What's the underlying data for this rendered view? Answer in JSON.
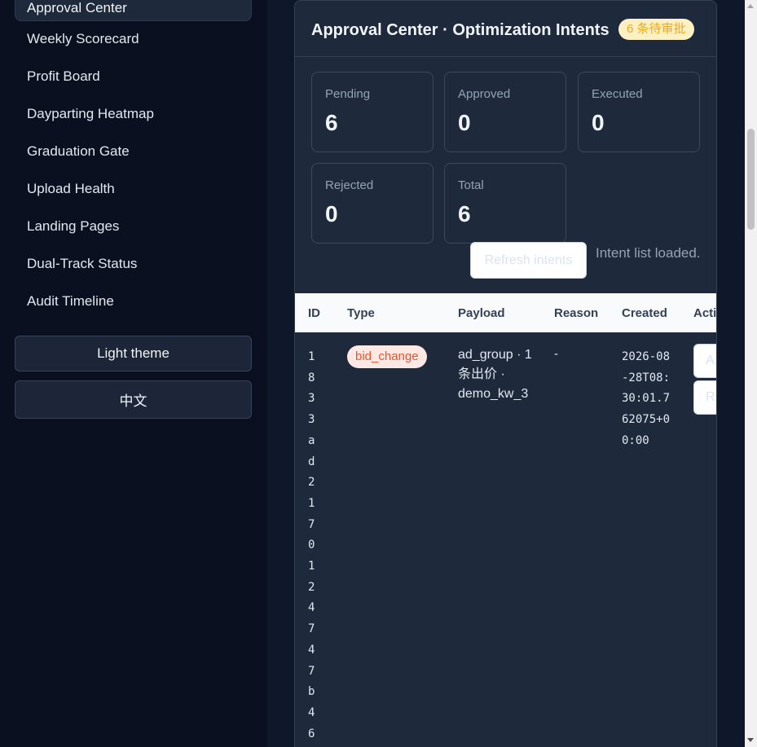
{
  "sidebar": {
    "active_item": "Approval Center",
    "items": [
      {
        "label": "Weekly Scorecard"
      },
      {
        "label": "Profit Board"
      },
      {
        "label": "Dayparting Heatmap"
      },
      {
        "label": "Graduation Gate"
      },
      {
        "label": "Upload Health"
      },
      {
        "label": "Landing Pages"
      },
      {
        "label": "Dual-Track Status"
      },
      {
        "label": "Audit Timeline"
      }
    ],
    "theme_button": "Light theme",
    "language_button": "中文"
  },
  "panel": {
    "title": "Approval Center · Optimization Intents",
    "pending_badge": "6 条待审批"
  },
  "stats": [
    {
      "label": "Pending",
      "value": "6"
    },
    {
      "label": "Approved",
      "value": "0"
    },
    {
      "label": "Executed",
      "value": "0"
    },
    {
      "label": "Rejected",
      "value": "0"
    },
    {
      "label": "Total",
      "value": "6"
    }
  ],
  "actions": {
    "refresh_label": "Refresh intents",
    "status_text": "Intent list loaded."
  },
  "table": {
    "headers": [
      "ID",
      "Type",
      "Payload",
      "Reason",
      "Created",
      "Acti"
    ],
    "rows": [
      {
        "id": "1833ad217012474 7b46",
        "type": "bid_change",
        "payload": "ad_group · 1 条出价 · demo_kw_3",
        "reason": "-",
        "created": "2026-08-28T08:30:01.762075+00:00",
        "approve_label": "A",
        "reject_label": "R"
      }
    ]
  },
  "colors": {
    "background": "#0c1222",
    "card": "#1e293b",
    "badge_bg": "#fdf0c2",
    "badge_text": "#f0a818",
    "pill_bg": "#fde8e4",
    "pill_text": "#e8542e"
  }
}
